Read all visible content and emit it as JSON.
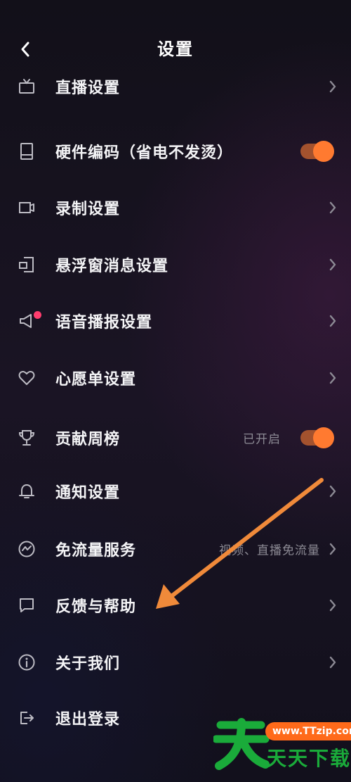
{
  "header": {
    "title": "设置"
  },
  "items": [
    {
      "label": "直播设置",
      "icon": "tv-icon",
      "type": "chevron"
    },
    {
      "label": "硬件编码（省电不发烫）",
      "icon": "tablet-icon",
      "type": "toggle",
      "on": true
    },
    {
      "label": "录制设置",
      "icon": "video-camera-icon",
      "type": "chevron"
    },
    {
      "label": "悬浮窗消息设置",
      "icon": "floating-window-icon",
      "type": "chevron"
    },
    {
      "label": "语音播报设置",
      "icon": "speaker-icon",
      "type": "chevron",
      "badge": true
    },
    {
      "label": "心愿单设置",
      "icon": "heart-icon",
      "type": "chevron"
    },
    {
      "label": "贡献周榜",
      "icon": "trophy-icon",
      "type": "toggle",
      "on": true,
      "sub": "已开启"
    },
    {
      "label": "通知设置",
      "icon": "bell-icon",
      "type": "chevron"
    },
    {
      "label": "免流量服务",
      "icon": "pulse-circle-icon",
      "type": "chevron",
      "sub": "视频、直播免流量"
    },
    {
      "label": "反馈与帮助",
      "icon": "chat-bubble-icon",
      "type": "chevron"
    },
    {
      "label": "关于我们",
      "icon": "info-icon",
      "type": "chevron"
    },
    {
      "label": "退出登录",
      "icon": "logout-icon",
      "type": "none"
    }
  ],
  "watermark": {
    "url": "www.TTzip.com",
    "brand": "天天下载"
  },
  "colors": {
    "accent": "#ff7a30",
    "toggle_track": "#a3522e",
    "badge": "#ff3d6e",
    "annotation_arrow": "#f08a3a",
    "watermark_green": "#1aab3a"
  }
}
